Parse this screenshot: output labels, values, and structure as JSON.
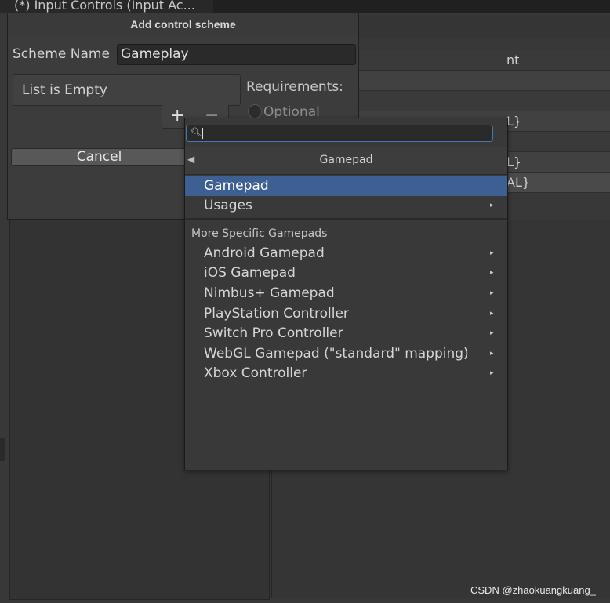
{
  "window": {
    "title": "(*) Input Controls (Input Ac..."
  },
  "background": {
    "rows": [
      "nt",
      "",
      "",
      "L}",
      "",
      "L}",
      "AL}"
    ]
  },
  "dialog": {
    "title": "Add control scheme",
    "scheme_name_label": "Scheme Name",
    "scheme_name_value": "Gameplay",
    "list_empty_text": "List is Empty",
    "plus_label": "+",
    "minus_label": "−",
    "requirements_label": "Requirements:",
    "optional_label": "Optional",
    "cancel_label": "Cancel"
  },
  "dropdown": {
    "search_icon": "search-icon",
    "search_value": "",
    "back_icon": "back-arrow-icon",
    "header_title": "Gamepad",
    "top_items": [
      {
        "label": "Gamepad",
        "selected": true,
        "has_submenu": false
      },
      {
        "label": "Usages",
        "selected": false,
        "has_submenu": true
      }
    ],
    "section_title": "More Specific Gamepads",
    "specific_items": [
      {
        "label": "Android Gamepad",
        "has_submenu": true
      },
      {
        "label": "iOS Gamepad",
        "has_submenu": true
      },
      {
        "label": "Nimbus+ Gamepad",
        "has_submenu": true
      },
      {
        "label": "PlayStation Controller",
        "has_submenu": true
      },
      {
        "label": "Switch Pro Controller",
        "has_submenu": true
      },
      {
        "label": "WebGL Gamepad (\"standard\" mapping)",
        "has_submenu": true
      },
      {
        "label": "Xbox Controller",
        "has_submenu": true
      }
    ],
    "submenu_arrow": "▸"
  },
  "watermark": "CSDN @zhaokuangkuang_",
  "colors": {
    "selection": "#3d5f91",
    "focus_border": "#3d7ab5",
    "background": "#383838"
  }
}
